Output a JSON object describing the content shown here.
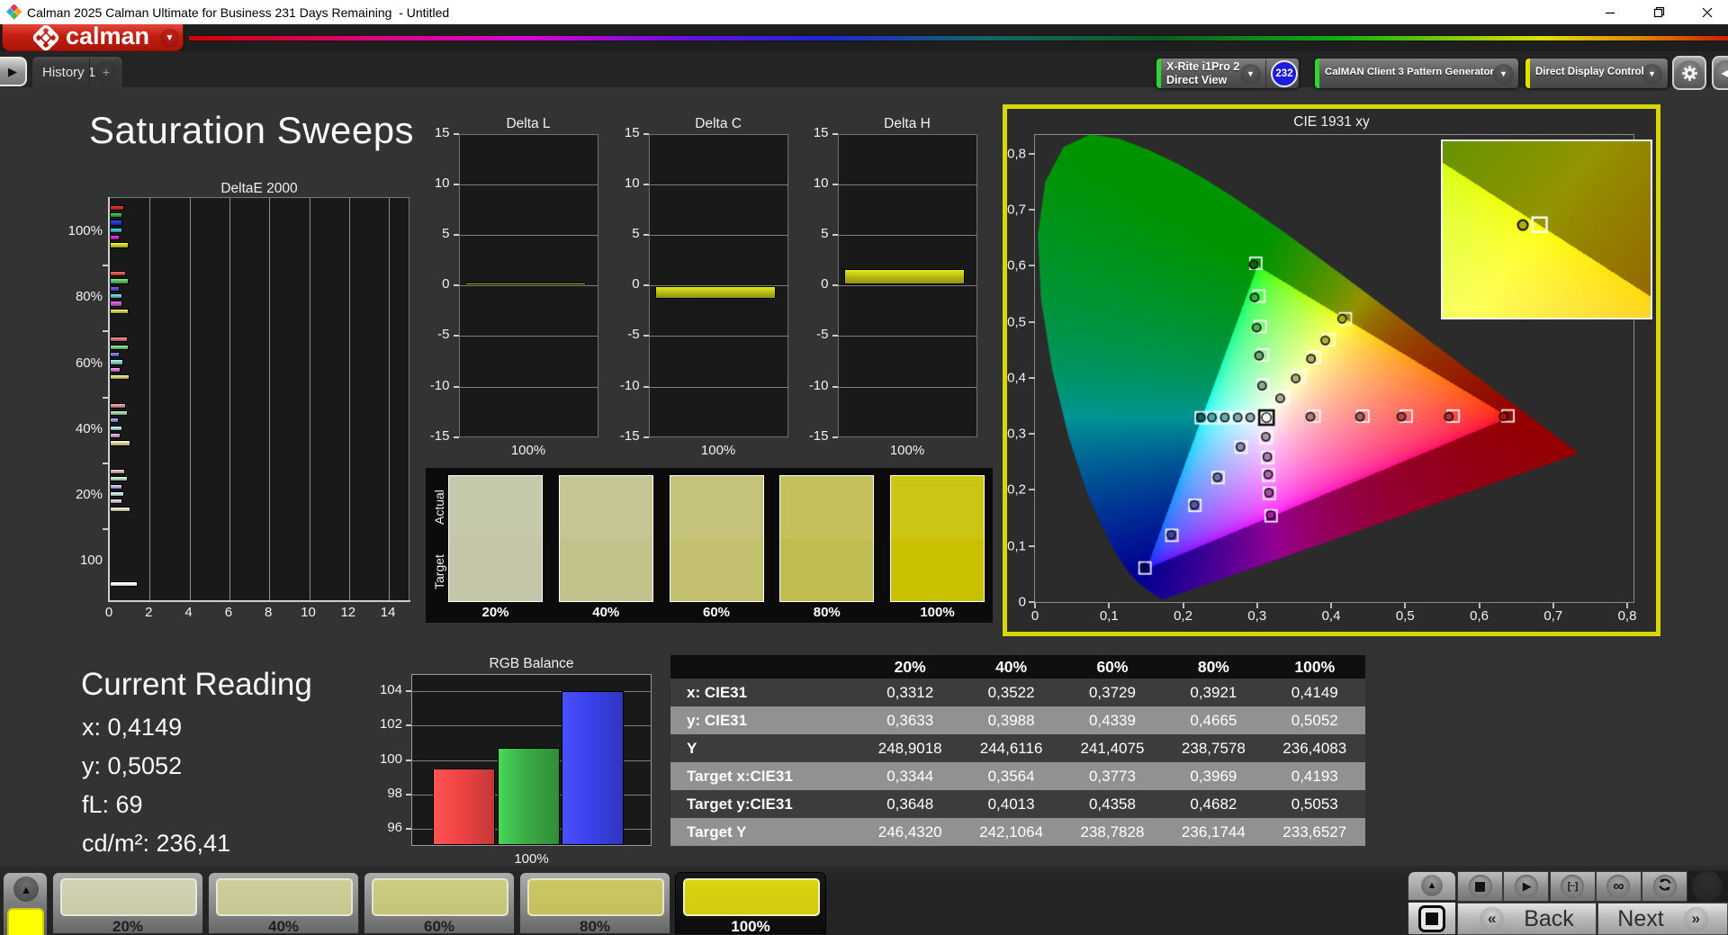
{
  "window": {
    "title": "Calman 2025 Calman Ultimate for Business 231 Days Remaining  - Untitled",
    "controls": {
      "minimize": "minimize",
      "maximize": "maximize",
      "close": "close"
    }
  },
  "brand": {
    "logo_text": "calman"
  },
  "tabs": {
    "history_label": "History 1",
    "add_label": "+"
  },
  "toolbar": {
    "meter": {
      "line1": "X-Rite i1Pro 2",
      "line2": "Direct View",
      "badge": "232",
      "accent": "#2fd42f"
    },
    "pattern_generator": {
      "label": "CalMAN Client 3 Pattern Generator",
      "accent": "#2fd42f"
    },
    "display_control": {
      "label": "Direct Display Control",
      "accent": "#e0e000"
    }
  },
  "page": {
    "title": "Saturation Sweeps"
  },
  "current_reading": {
    "title": "Current Reading",
    "lines": [
      "x: 0,4149",
      "y: 0,5052",
      "fL: 69",
      "cd/m²: 236,41"
    ]
  },
  "swatch_panel": {
    "row_labels": [
      "Actual",
      "Target"
    ],
    "columns": [
      {
        "label": "20%",
        "actual": "#c6c8ab",
        "target": "#c4c6a7"
      },
      {
        "label": "40%",
        "actual": "#c5c592",
        "target": "#c2c38c"
      },
      {
        "label": "60%",
        "actual": "#c5c379",
        "target": "#c2c06f"
      },
      {
        "label": "80%",
        "actual": "#c4c15c",
        "target": "#c0bd50"
      },
      {
        "label": "100%",
        "actual": "#cbc513",
        "target": "#c8c001"
      }
    ]
  },
  "chart_data": [
    {
      "id": "deltae2000",
      "type": "bar",
      "orientation": "horizontal",
      "title": "DeltaE 2000",
      "xlim": [
        0,
        15.1
      ],
      "xticks": [
        0,
        2,
        4,
        6,
        8,
        10,
        12,
        14
      ],
      "groups": [
        {
          "label": "100%",
          "colors": [
            "#d02a24",
            "#2fae3c",
            "#2c35cf",
            "#33b7c4",
            "#c32bc3",
            "#c9cd2a"
          ],
          "values": [
            0.7,
            0.63,
            0.64,
            0.63,
            0.49,
            0.95
          ]
        },
        {
          "label": "80%",
          "colors": [
            "#d4524b",
            "#56bd60",
            "#4f55d2",
            "#5ec3cc",
            "#c854c8",
            "#cdc957"
          ],
          "values": [
            0.81,
            0.96,
            0.48,
            0.64,
            0.61,
            0.97
          ]
        },
        {
          "label": "60%",
          "colors": [
            "#d6726c",
            "#78c77f",
            "#6f74d7",
            "#84cdd2",
            "#cd78cf",
            "#d2cd78"
          ],
          "values": [
            0.89,
            0.95,
            0.49,
            0.67,
            0.56,
            0.98
          ]
        },
        {
          "label": "40%",
          "colors": [
            "#d68e89",
            "#97d29c",
            "#8e92dc",
            "#a5d8da",
            "#d49bd8",
            "#d8d49a"
          ],
          "values": [
            0.81,
            0.9,
            0.47,
            0.65,
            0.56,
            1.02
          ]
        },
        {
          "label": "20%",
          "colors": [
            "#d8aaa7",
            "#b4dcb6",
            "#adb0e0",
            "#c0e1e2",
            "#dabade",
            "#dedbb4"
          ],
          "values": [
            0.77,
            0.91,
            0.65,
            0.73,
            0.62,
            1.06
          ]
        },
        {
          "label": "100",
          "colors": [
            "#ffffff"
          ],
          "values": [
            1.4
          ],
          "single": true
        }
      ]
    },
    {
      "id": "delta_l",
      "type": "bar",
      "title": "Delta L",
      "ylim": [
        -15,
        15
      ],
      "yticks": [
        15,
        10,
        5,
        0,
        -5,
        -10,
        -15
      ],
      "xlabel": "100%",
      "bar": {
        "from": 0.0,
        "to": 0.3
      },
      "bar_color": "#b6ba15"
    },
    {
      "id": "delta_c",
      "type": "bar",
      "title": "Delta C",
      "ylim": [
        -15,
        15
      ],
      "yticks": [
        15,
        10,
        5,
        0,
        -5,
        -10,
        -15
      ],
      "xlabel": "100%",
      "bar": {
        "from": -0.1,
        "to": -1.3
      },
      "bar_color": "#b6ba15"
    },
    {
      "id": "delta_h",
      "type": "bar",
      "title": "Delta H",
      "ylim": [
        -15,
        15
      ],
      "yticks": [
        15,
        10,
        5,
        0,
        -5,
        -10,
        -15
      ],
      "xlabel": "100%",
      "bar": {
        "from": 0.15,
        "to": 1.65
      },
      "bar_color": "#b6ba15"
    },
    {
      "id": "cie1931",
      "type": "scatter",
      "title": "CIE 1931 xy",
      "xlim": [
        0,
        0.808
      ],
      "ylim": [
        0,
        0.834
      ],
      "xtick_labels": [
        "0",
        "0,1",
        "0,2",
        "0,3",
        "0,4",
        "0,5",
        "0,6",
        "0,7",
        "0,8"
      ],
      "ytick_labels": [
        "0",
        "0,1",
        "0,2",
        "0,3",
        "0,4",
        "0,5",
        "0,6",
        "0,7",
        "0,8"
      ],
      "white_point": {
        "x": 0.3127,
        "y": 0.329
      },
      "sweeps": [
        {
          "name": "red",
          "targets": [
            [
              0.377,
              0.3315
            ],
            [
              0.443,
              0.3315
            ],
            [
              0.5015,
              0.3316
            ],
            [
              0.565,
              0.3317
            ],
            [
              0.639,
              0.332
            ]
          ],
          "measured": [
            [
              0.372,
              0.3305
            ],
            [
              0.439,
              0.3305
            ],
            [
              0.495,
              0.3306
            ],
            [
              0.559,
              0.3307
            ],
            [
              0.633,
              0.331
            ]
          ]
        },
        {
          "name": "green",
          "targets": [
            [
              0.308,
              0.3869
            ],
            [
              0.3075,
              0.4407
            ],
            [
              0.3043,
              0.4913
            ],
            [
              0.3024,
              0.5457
            ],
            [
              0.2983,
              0.6042
            ]
          ],
          "measured": [
            [
              0.3067,
              0.3859
            ],
            [
              0.3027,
              0.4394
            ],
            [
              0.2994,
              0.4895
            ],
            [
              0.2967,
              0.5433
            ],
            [
              0.2954,
              0.6021
            ]
          ]
        },
        {
          "name": "blue",
          "targets": [
            [
              0.2785,
              0.2761
            ],
            [
              0.2474,
              0.2219
            ],
            [
              0.2161,
              0.1724
            ],
            [
              0.1849,
              0.119
            ],
            [
              0.1486,
              0.0607
            ]
          ],
          "measured": [
            [
              0.2775,
              0.2768
            ],
            [
              0.2465,
              0.2225
            ],
            [
              0.2152,
              0.1732
            ],
            [
              0.1842,
              0.1198
            ],
            [
              0.1482,
              0.0614
            ]
          ]
        },
        {
          "name": "cyan",
          "targets": [
            [
              0.2246,
              0.3288
            ],
            [
              0.2407,
              0.3289
            ],
            [
              0.2568,
              0.329
            ],
            [
              0.2729,
              0.3291
            ],
            [
              0.289,
              0.3292
            ]
          ],
          "measured": [
            [
              0.2241,
              0.3292
            ],
            [
              0.2389,
              0.3292
            ],
            [
              0.2564,
              0.3292
            ],
            [
              0.2739,
              0.3292
            ],
            [
              0.2908,
              0.3292
            ]
          ]
        },
        {
          "name": "magenta",
          "targets": [
            [
              0.3125,
              0.2936
            ],
            [
              0.3145,
              0.2577
            ],
            [
              0.3156,
              0.2263
            ],
            [
              0.3167,
              0.1938
            ],
            [
              0.319,
              0.1538
            ]
          ],
          "measured": [
            [
              0.3118,
              0.2948
            ],
            [
              0.3138,
              0.259
            ],
            [
              0.315,
              0.2276
            ],
            [
              0.316,
              0.195
            ],
            [
              0.3183,
              0.1552
            ]
          ]
        },
        {
          "name": "yellow",
          "targets": [
            [
              0.3344,
              0.3648
            ],
            [
              0.3564,
              0.4013
            ],
            [
              0.3773,
              0.4358
            ],
            [
              0.3969,
              0.4682
            ],
            [
              0.4193,
              0.5053
            ]
          ],
          "measured": [
            [
              0.3312,
              0.3633
            ],
            [
              0.3522,
              0.3988
            ],
            [
              0.3729,
              0.4339
            ],
            [
              0.3921,
              0.4665
            ],
            [
              0.4149,
              0.5052
            ]
          ]
        }
      ],
      "inset": {
        "x_range": [
          0.3937,
          0.4487
        ],
        "y_range": [
          0.475,
          0.5325
        ],
        "measured": [
          0.4149,
          0.5052
        ],
        "target": [
          0.4193,
          0.5053
        ]
      }
    },
    {
      "id": "rgb_balance",
      "type": "bar",
      "title": "RGB Balance",
      "categories": [
        "Red",
        "Green",
        "Blue"
      ],
      "values": [
        99.5,
        100.7,
        104.0
      ],
      "colors": [
        "#ef4343",
        "#3aac47",
        "#3a41ea"
      ],
      "ylim": [
        95,
        105
      ],
      "yticks": [
        104,
        102,
        100,
        98,
        96
      ],
      "xlabel": "100%"
    },
    {
      "id": "measurement_table",
      "type": "table",
      "columns": [
        "",
        "20%",
        "40%",
        "60%",
        "80%",
        "100%"
      ],
      "rows": [
        {
          "label": "x: CIE31",
          "values": [
            "0,3312",
            "0,3522",
            "0,3729",
            "0,3921",
            "0,4149"
          ]
        },
        {
          "label": "y: CIE31",
          "values": [
            "0,3633",
            "0,3988",
            "0,4339",
            "0,4665",
            "0,5052"
          ]
        },
        {
          "label": "Y",
          "values": [
            "248,9018",
            "244,6116",
            "241,4075",
            "238,7578",
            "236,4083"
          ]
        },
        {
          "label": "Target x:CIE31",
          "values": [
            "0,3344",
            "0,3564",
            "0,3773",
            "0,3969",
            "0,4193"
          ]
        },
        {
          "label": "Target y:CIE31",
          "values": [
            "0,3648",
            "0,4013",
            "0,4358",
            "0,4682",
            "0,5053"
          ]
        },
        {
          "label": "Target Y",
          "values": [
            "246,4320",
            "242,1064",
            "238,7828",
            "236,1744",
            "233,6527"
          ]
        }
      ]
    }
  ],
  "bottom_bar": {
    "selector_color": "#ffff00",
    "samples": [
      {
        "label": "20%",
        "color": "#c9cbab",
        "selected": false
      },
      {
        "label": "40%",
        "color": "#c6c793",
        "selected": false
      },
      {
        "label": "60%",
        "color": "#c5c47a",
        "selected": false
      },
      {
        "label": "80%",
        "color": "#c3c05e",
        "selected": false
      },
      {
        "label": "100%",
        "color": "#d3ca10",
        "selected": true
      }
    ],
    "transport": [
      "stop",
      "play",
      "pattern-insert",
      "loop",
      "refresh"
    ]
  },
  "nav": {
    "back_label": "Back",
    "next_label": "Next"
  }
}
